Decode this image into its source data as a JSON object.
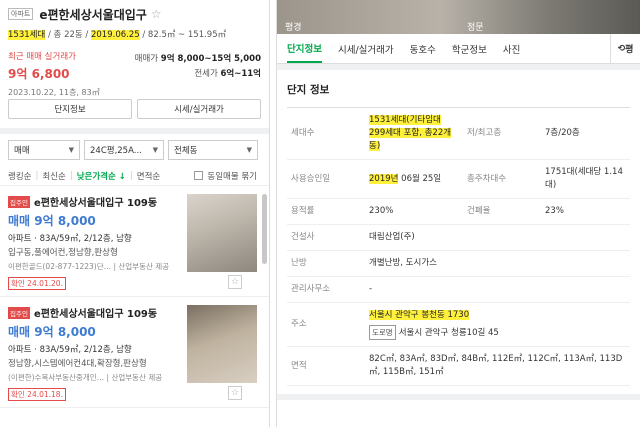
{
  "left": {
    "badge": "아파트",
    "title": "e편한세상서울대입구",
    "households": "1531세대",
    "floors_sep": " / 총 22동 / ",
    "approval": "2019.06.25",
    "area_range": " / 82.5㎡ ~ 151.95㎡",
    "recent_label": "최근 매매 실거래가",
    "recent_price": "9억 6,800",
    "recent_meta": "2023.10.22, 11층, 83㎡",
    "sale_label": "매매가",
    "sale_range": "9억 8,000~15억 5,000",
    "jeonse_label": "전세가",
    "jeonse_range": "6억~11억",
    "btn_info": "단지정보",
    "btn_price": "시세/실거래가",
    "filters": [
      "매매",
      "24C평,25A...",
      "전체동"
    ],
    "sort": {
      "items": [
        "랭킹순",
        "최신순",
        "낮은가격순 ↓",
        "면적순"
      ],
      "same_listing": "동일매물 묶기"
    },
    "listings": [
      {
        "badge": "집주인",
        "name": "e편한세상서울대입구 109동",
        "price": "매매 9억 8,000",
        "type": "아파트 · 83A/59㎡, 2/12층, 남향",
        "desc": "입구동,풀에어컨,정남향,판상형",
        "agent": "이편한골드(02-877-1223)단…  |  산업부동산 제공",
        "confirm": "확인 24.01.20."
      },
      {
        "badge": "집주인",
        "name": "e편한세상서울대입구 109동",
        "price": "매매 9억 8,000",
        "type": "아파트 · 83A/59㎡, 2/12층, 남향",
        "desc": "정남향,시스템에어컨4대,확장형,판상형",
        "agent": "(이편한)수복사부동산중개인…  |  산업부동산 제공",
        "confirm": "확인 24.01.18."
      }
    ]
  },
  "right": {
    "photo_captions": [
      "평경",
      "정문"
    ],
    "tabs": [
      "단지정보",
      "시세/실거래가",
      "동호수",
      "학군정보",
      "사진"
    ],
    "share": "평",
    "section_title": "단지 정보",
    "rows": [
      {
        "l1": "세대수",
        "v1": "1531세대(기타임대 299세대 포함, 총22개동)",
        "l2": "저/최고층",
        "v2": "7층/20층"
      },
      {
        "l1": "사용승인일",
        "v1a": "2019년",
        "v1b": " 06월 25일",
        "l2": "총주차대수",
        "v2": "1751대(세대당 1.14대)"
      },
      {
        "l1": "용적률",
        "v1": "230%",
        "l2": "건폐율",
        "v2": "23%"
      }
    ],
    "builder_label": "건설사",
    "builder": "대림산업(주)",
    "heating_label": "난방",
    "heating": "개별난방, 도시가스",
    "office_label": "관리사무소",
    "office": "-",
    "address_label": "주소",
    "address": "서울시 관악구 봉천동 1730",
    "road_tag": "도로명",
    "road_address": "서울시 관악구 청룡10길 45",
    "area_label": "면적",
    "areas": "82C㎡, 83A㎡, 83D㎡, 84B㎡, 112E㎡, 112C㎡, 113A㎡, 113D㎡, 115B㎡, 151㎡"
  }
}
